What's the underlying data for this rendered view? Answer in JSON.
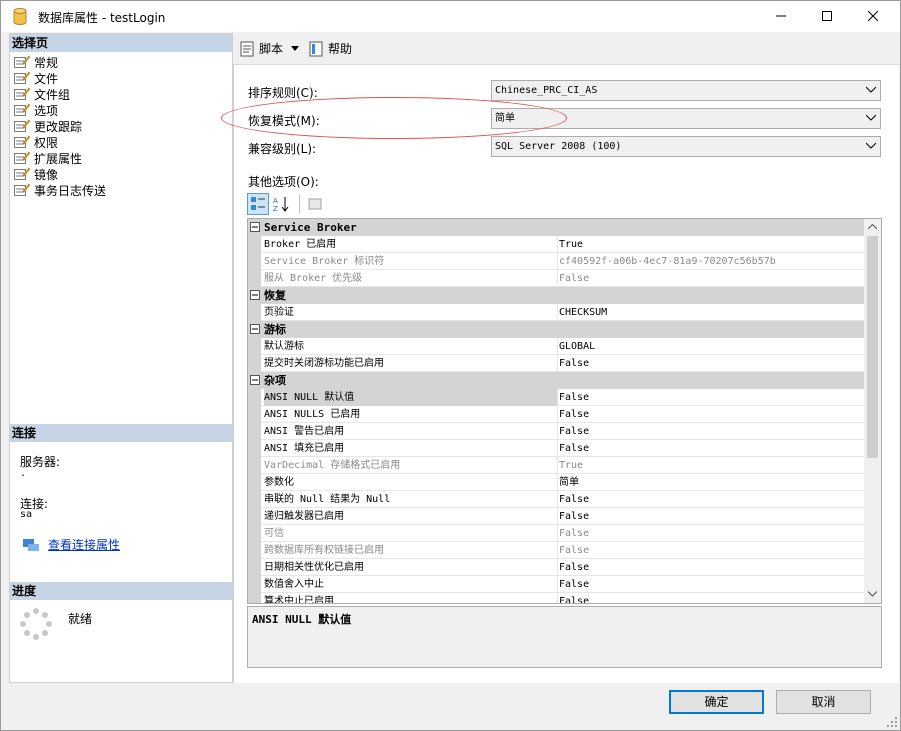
{
  "window": {
    "title": "数据库属性 - testLogin",
    "minimize": "minimize-icon",
    "maximize": "maximize-icon",
    "close": "close-icon"
  },
  "left": {
    "select_page_header": "选择页",
    "pages": [
      {
        "label": "常规",
        "icon": "page-icon"
      },
      {
        "label": "文件",
        "icon": "page-icon"
      },
      {
        "label": "文件组",
        "icon": "page-icon"
      },
      {
        "label": "选项",
        "icon": "page-icon"
      },
      {
        "label": "更改跟踪",
        "icon": "page-icon"
      },
      {
        "label": "权限",
        "icon": "page-icon"
      },
      {
        "label": "扩展属性",
        "icon": "page-icon"
      },
      {
        "label": "镜像",
        "icon": "page-icon"
      },
      {
        "label": "事务日志传送",
        "icon": "page-icon"
      }
    ],
    "connection_header": "连接",
    "server_label": "服务器:",
    "server_value": ".",
    "connection_label": "连接:",
    "connection_value": "sa",
    "view_conn_props": "查看连接属性",
    "progress_header": "进度",
    "status": "就绪"
  },
  "toolbar": {
    "script_label": "脚本",
    "help_label": "帮助"
  },
  "form": {
    "collation_label": "排序规则(C):",
    "collation_value": "Chinese_PRC_CI_AS",
    "recovery_label": "恢复模式(M):",
    "recovery_value": "简单",
    "compat_label": "兼容级别(L):",
    "compat_value": "SQL Server 2008 (100)",
    "other_options_label": "其他选项(O):"
  },
  "grid": {
    "rows": [
      {
        "type": "cat",
        "name": "Service Broker"
      },
      {
        "type": "prop",
        "name": "Broker 已启用",
        "value": "True",
        "dim": false
      },
      {
        "type": "prop",
        "name": "Service Broker 标识符",
        "value": "cf40592f-a06b-4ec7-81a9-70207c56b57b",
        "dim": true
      },
      {
        "type": "prop",
        "name": "服从 Broker 优先级",
        "value": "False",
        "dim": true
      },
      {
        "type": "cat",
        "name": "恢复"
      },
      {
        "type": "prop",
        "name": "页验证",
        "value": "CHECKSUM",
        "dim": false
      },
      {
        "type": "cat",
        "name": "游标"
      },
      {
        "type": "prop",
        "name": "默认游标",
        "value": "GLOBAL",
        "dim": false
      },
      {
        "type": "prop",
        "name": "提交时关闭游标功能已启用",
        "value": "False",
        "dim": false
      },
      {
        "type": "cat",
        "name": "杂项"
      },
      {
        "type": "prop",
        "name": "ANSI NULL 默认值",
        "value": "False",
        "dim": false,
        "selected": true
      },
      {
        "type": "prop",
        "name": "ANSI NULLS 已启用",
        "value": "False",
        "dim": false
      },
      {
        "type": "prop",
        "name": "ANSI 警告已启用",
        "value": "False",
        "dim": false
      },
      {
        "type": "prop",
        "name": "ANSI 填充已启用",
        "value": "False",
        "dim": false
      },
      {
        "type": "prop",
        "name": "VarDecimal 存储格式已启用",
        "value": "True",
        "dim": true
      },
      {
        "type": "prop",
        "name": "参数化",
        "value": "简单",
        "dim": false
      },
      {
        "type": "prop",
        "name": "串联的 Null 结果为 Null",
        "value": "False",
        "dim": false
      },
      {
        "type": "prop",
        "name": "递归触发器已启用",
        "value": "False",
        "dim": false
      },
      {
        "type": "prop",
        "name": "可信",
        "value": "False",
        "dim": true
      },
      {
        "type": "prop",
        "name": "跨数据库所有权链接已启用",
        "value": "False",
        "dim": true
      },
      {
        "type": "prop",
        "name": "日期相关性优化已启用",
        "value": "False",
        "dim": false
      },
      {
        "type": "prop",
        "name": "数值舍入中止",
        "value": "False",
        "dim": false
      },
      {
        "type": "prop",
        "name": "算术中止已启用",
        "value": "False",
        "dim": false
      }
    ],
    "description": "ANSI NULL 默认值"
  },
  "buttons": {
    "ok": "确定",
    "cancel": "取消"
  },
  "colors": {
    "header_bg": "#c6d5e5",
    "category_bg": "#d4d4d4",
    "link": "#0033cc",
    "primary_border": "#0078d7",
    "annotation": "#e05050"
  }
}
